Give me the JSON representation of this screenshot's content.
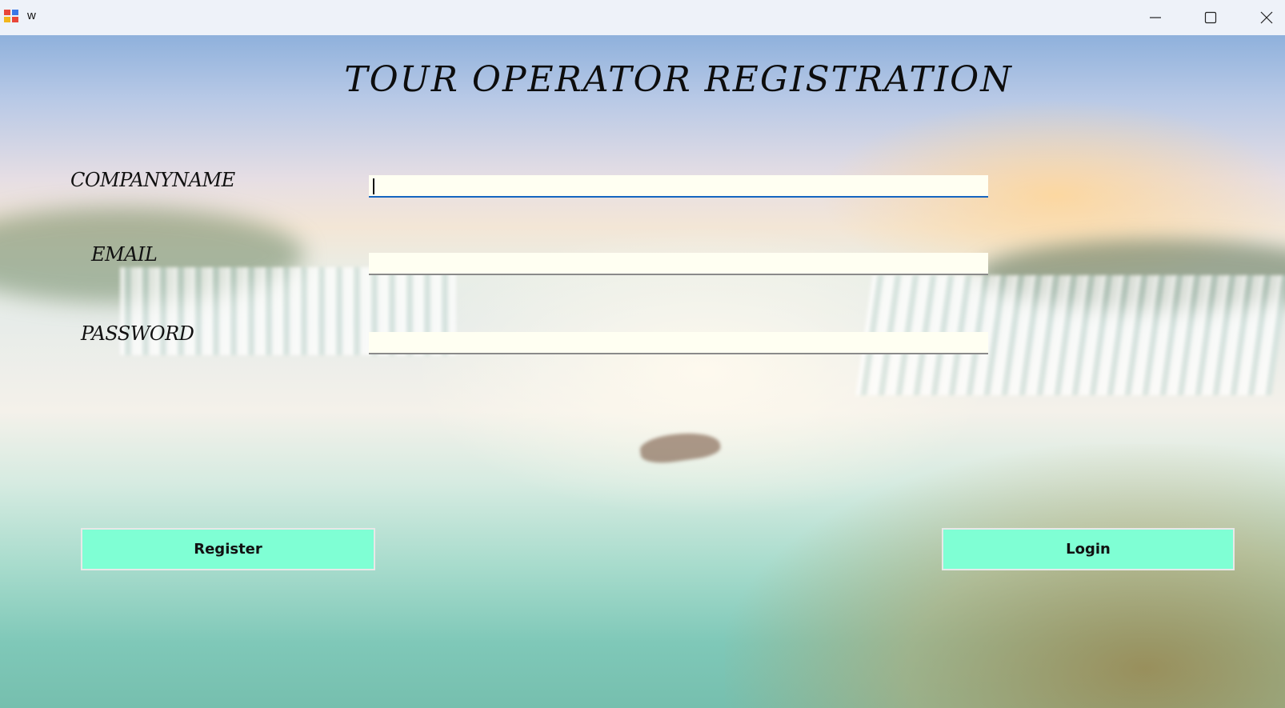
{
  "window": {
    "title": "w",
    "icons": {
      "app": "app-icon",
      "minimize": "minimize-icon",
      "maximize": "maximize-icon",
      "close": "close-icon"
    }
  },
  "form": {
    "heading": "TOUR OPERATOR REGISTRATION",
    "fields": [
      {
        "label": "COMPANYNAME",
        "value": "",
        "focused": true
      },
      {
        "label": "EMAIL",
        "value": ""
      },
      {
        "label": "PASSWORD",
        "value": ""
      }
    ],
    "register_label": "Register",
    "login_label": "Login"
  },
  "colors": {
    "button": "#7fffd4",
    "field": "#fffff2",
    "focus_underline": "#1565c0"
  }
}
